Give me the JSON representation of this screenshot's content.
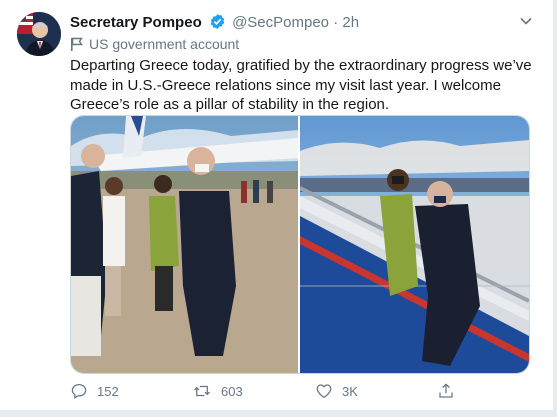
{
  "tweet": {
    "display_name": "Secretary Pompeo",
    "handle": "@SecPompeo",
    "separator": "·",
    "time": "2h",
    "account_label": "US government account",
    "text": "Departing Greece today, gratified by the extraordinary progress we’ve made in U.S.-Greece relations since my visit last year. I welcome Greece’s role as a pillar of stability in the region."
  },
  "actions": {
    "reply_count": "152",
    "retweet_count": "603",
    "like_count": "3K"
  },
  "colors": {
    "verified": "#1da1f2",
    "secondary_text": "#657786",
    "primary_text": "#14171a"
  },
  "icons": [
    "verified-badge-icon",
    "chevron-down-icon",
    "flag-icon",
    "reply-icon",
    "retweet-icon",
    "like-icon",
    "share-icon"
  ]
}
